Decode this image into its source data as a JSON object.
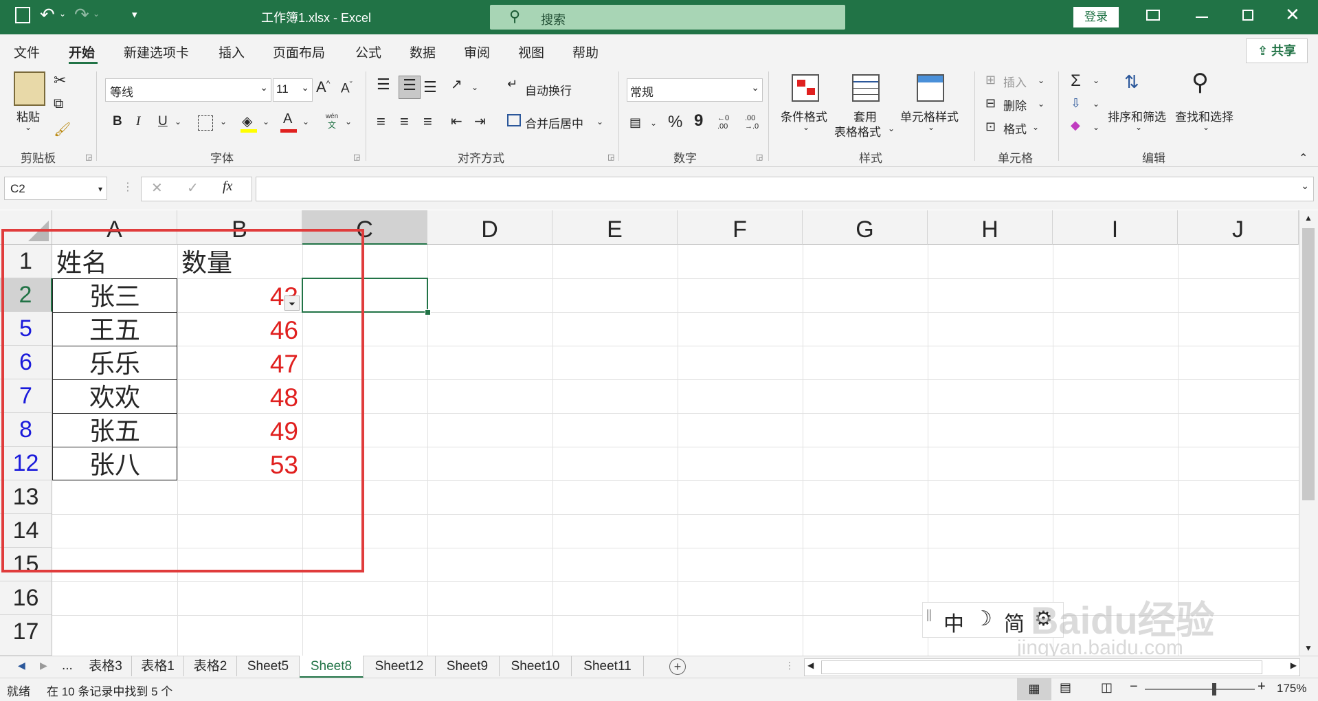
{
  "titlebar": {
    "doc_title": "工作簿1.xlsx  -  Excel",
    "search_label": "搜索",
    "login_label": "登录"
  },
  "ribbon_tabs": {
    "items": [
      "文件",
      "开始",
      "新建选项卡",
      "插入",
      "页面布局",
      "公式",
      "数据",
      "审阅",
      "视图",
      "帮助"
    ],
    "active": "开始",
    "share_label": "共享"
  },
  "clipboard": {
    "paste_label": "粘贴",
    "group_label": "剪贴板"
  },
  "font": {
    "family": "等线",
    "size": "11",
    "group_label": "字体",
    "bold": "B",
    "italic": "I",
    "underline": "U",
    "increase": "A",
    "decrease": "A",
    "phonetic_top": "wén",
    "phonetic_bottom": "文"
  },
  "alignment": {
    "wrap_label": "自动换行",
    "merge_label": "合并后居中",
    "group_label": "对齐方式"
  },
  "number": {
    "format": "常规",
    "percent": "%",
    "comma": "9",
    "inc_top": "←0",
    "inc_bottom": ".00",
    "dec_top": ".00",
    "dec_bottom": "→.0",
    "group_label": "数字"
  },
  "styles": {
    "conditional_label": "条件格式",
    "table_label_1": "套用",
    "table_label_2": "表格格式",
    "cell_style_label": "单元格样式",
    "group_label": "样式"
  },
  "cells_group": {
    "insert_label": "插入",
    "delete_label": "删除",
    "format_label": "格式",
    "group_label": "单元格"
  },
  "editing": {
    "sort_label": "排序和筛选",
    "find_label": "查找和选择",
    "group_label": "编辑"
  },
  "formula_bar": {
    "name_box": "C2",
    "fx": "fx",
    "cancel": "✕",
    "enter": "✓"
  },
  "columns": [
    "A",
    "B",
    "C",
    "D",
    "E",
    "F",
    "G",
    "H",
    "I",
    "J"
  ],
  "rows": [
    "1",
    "2",
    "5",
    "6",
    "7",
    "8",
    "12",
    "13",
    "14",
    "15",
    "16",
    "17"
  ],
  "cells": {
    "A1": "姓名",
    "B1": "数量",
    "A2": "张三",
    "B2": "43",
    "A5": "王五",
    "B5": "46",
    "A6": "乐乐",
    "B6": "47",
    "A7": "欢欢",
    "B7": "48",
    "A8": "张五",
    "B8": "49",
    "A12": "张八",
    "B12": "53"
  },
  "sheet_tabs": {
    "ellipsis": "...",
    "items": [
      "表格3",
      "表格1",
      "表格2",
      "Sheet5",
      "Sheet8",
      "Sheet12",
      "Sheet9",
      "Sheet10",
      "Sheet11"
    ],
    "active": "Sheet8"
  },
  "status": {
    "ready": "就绪",
    "message": "在 10 条记录中找到 5 个",
    "zoom": "175%",
    "minus": "−",
    "plus": "+"
  },
  "ime": {
    "items": [
      "中",
      "☽",
      "简",
      "⚙"
    ]
  },
  "watermark": {
    "text": "Baidu经验",
    "url": "jingyan.baidu.com"
  },
  "colors": {
    "excel_green": "#217346",
    "filtered_row_blue": "#1a1adb",
    "number_red": "#e0201f",
    "highlight_box": "#e03c3c"
  }
}
